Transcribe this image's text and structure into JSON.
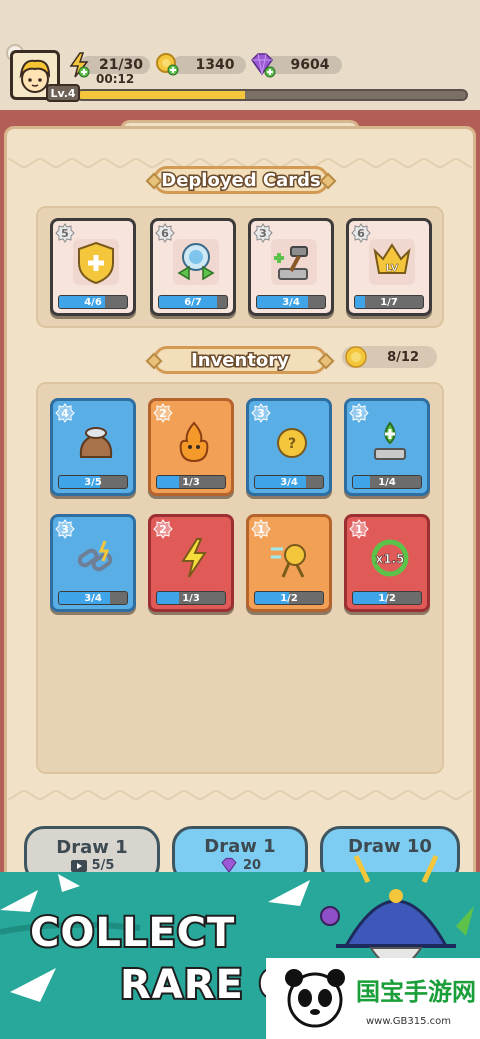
{
  "hud": {
    "level": "Lv.4",
    "energy": "21/30",
    "energy_timer": "00:12",
    "gold": "1340",
    "gems": "9604",
    "xp_progress": 0.43
  },
  "deployed": {
    "title": "Deployed Cards",
    "cards": [
      {
        "level": "5",
        "progress": "4/6",
        "ratio": 0.67,
        "icon": "shield-plus-icon"
      },
      {
        "level": "6",
        "progress": "6/7",
        "ratio": 0.86,
        "icon": "crystal-orb-icon"
      },
      {
        "level": "3",
        "progress": "3/4",
        "ratio": 0.75,
        "icon": "hammer-anvil-icon"
      },
      {
        "level": "6",
        "progress": "1/7",
        "ratio": 0.14,
        "icon": "level-up-creature-icon"
      }
    ]
  },
  "inventory": {
    "title": "Inventory",
    "count": "8/12",
    "cards": [
      {
        "level": "4",
        "progress": "3/5",
        "ratio": 0.6,
        "color": "blue",
        "icon": "coin-sack-icon"
      },
      {
        "level": "2",
        "progress": "1/3",
        "ratio": 0.33,
        "color": "orange",
        "icon": "fire-creature-icon"
      },
      {
        "level": "3",
        "progress": "3/4",
        "ratio": 0.75,
        "color": "blue",
        "icon": "mystery-creature-icon"
      },
      {
        "level": "3",
        "progress": "1/4",
        "ratio": 0.25,
        "color": "blue",
        "icon": "altar-upgrade-icon"
      },
      {
        "level": "3",
        "progress": "3/4",
        "ratio": 0.75,
        "color": "blue",
        "icon": "chain-link-icon"
      },
      {
        "level": "2",
        "progress": "1/3",
        "ratio": 0.33,
        "color": "red",
        "icon": "lightning-icon"
      },
      {
        "level": "1",
        "progress": "1/2",
        "ratio": 0.5,
        "color": "orange",
        "icon": "dash-creature-icon"
      },
      {
        "level": "1",
        "progress": "1/2",
        "ratio": 0.5,
        "color": "red",
        "icon": "speed-x1-5-icon"
      }
    ]
  },
  "draw": {
    "draw1_ad": {
      "label": "Draw 1",
      "sub": "5/5"
    },
    "draw1_gem": {
      "label": "Draw 1",
      "sub": "20"
    },
    "draw10": {
      "label": "Draw 10"
    }
  },
  "promo": {
    "line1": "COLLECT",
    "line2": "RARE C",
    "watermark_cn": "国宝手游网",
    "watermark_url": "www.GB315.com"
  },
  "colors": {
    "blue_card": "#5aaee6",
    "orange_card": "#f1a055",
    "red_card": "#e05a58",
    "progress_fill": "#3fa4e8",
    "promo_bg": "#27a89a"
  }
}
